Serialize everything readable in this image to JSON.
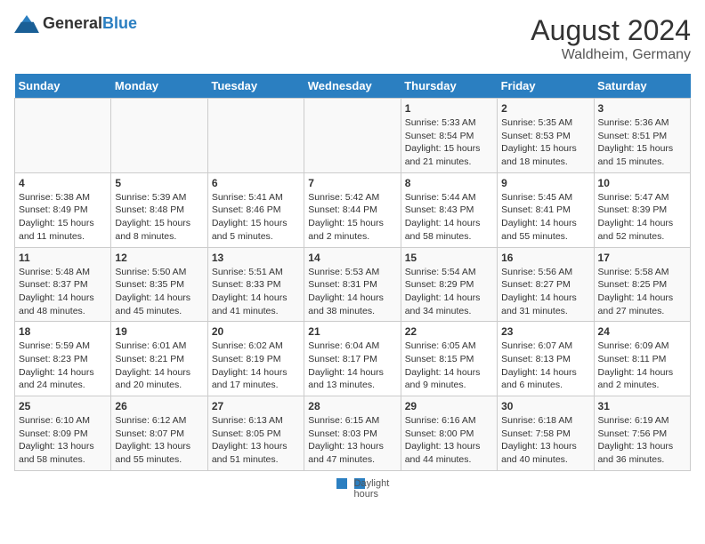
{
  "logo": {
    "text_general": "General",
    "text_blue": "Blue"
  },
  "title": {
    "month_year": "August 2024",
    "location": "Waldheim, Germany"
  },
  "calendar": {
    "headers": [
      "Sunday",
      "Monday",
      "Tuesday",
      "Wednesday",
      "Thursday",
      "Friday",
      "Saturday"
    ],
    "weeks": [
      [
        {
          "day": "",
          "info": ""
        },
        {
          "day": "",
          "info": ""
        },
        {
          "day": "",
          "info": ""
        },
        {
          "day": "",
          "info": ""
        },
        {
          "day": "1",
          "info": "Sunrise: 5:33 AM\nSunset: 8:54 PM\nDaylight: 15 hours and 21 minutes."
        },
        {
          "day": "2",
          "info": "Sunrise: 5:35 AM\nSunset: 8:53 PM\nDaylight: 15 hours and 18 minutes."
        },
        {
          "day": "3",
          "info": "Sunrise: 5:36 AM\nSunset: 8:51 PM\nDaylight: 15 hours and 15 minutes."
        }
      ],
      [
        {
          "day": "4",
          "info": "Sunrise: 5:38 AM\nSunset: 8:49 PM\nDaylight: 15 hours and 11 minutes."
        },
        {
          "day": "5",
          "info": "Sunrise: 5:39 AM\nSunset: 8:48 PM\nDaylight: 15 hours and 8 minutes."
        },
        {
          "day": "6",
          "info": "Sunrise: 5:41 AM\nSunset: 8:46 PM\nDaylight: 15 hours and 5 minutes."
        },
        {
          "day": "7",
          "info": "Sunrise: 5:42 AM\nSunset: 8:44 PM\nDaylight: 15 hours and 2 minutes."
        },
        {
          "day": "8",
          "info": "Sunrise: 5:44 AM\nSunset: 8:43 PM\nDaylight: 14 hours and 58 minutes."
        },
        {
          "day": "9",
          "info": "Sunrise: 5:45 AM\nSunset: 8:41 PM\nDaylight: 14 hours and 55 minutes."
        },
        {
          "day": "10",
          "info": "Sunrise: 5:47 AM\nSunset: 8:39 PM\nDaylight: 14 hours and 52 minutes."
        }
      ],
      [
        {
          "day": "11",
          "info": "Sunrise: 5:48 AM\nSunset: 8:37 PM\nDaylight: 14 hours and 48 minutes."
        },
        {
          "day": "12",
          "info": "Sunrise: 5:50 AM\nSunset: 8:35 PM\nDaylight: 14 hours and 45 minutes."
        },
        {
          "day": "13",
          "info": "Sunrise: 5:51 AM\nSunset: 8:33 PM\nDaylight: 14 hours and 41 minutes."
        },
        {
          "day": "14",
          "info": "Sunrise: 5:53 AM\nSunset: 8:31 PM\nDaylight: 14 hours and 38 minutes."
        },
        {
          "day": "15",
          "info": "Sunrise: 5:54 AM\nSunset: 8:29 PM\nDaylight: 14 hours and 34 minutes."
        },
        {
          "day": "16",
          "info": "Sunrise: 5:56 AM\nSunset: 8:27 PM\nDaylight: 14 hours and 31 minutes."
        },
        {
          "day": "17",
          "info": "Sunrise: 5:58 AM\nSunset: 8:25 PM\nDaylight: 14 hours and 27 minutes."
        }
      ],
      [
        {
          "day": "18",
          "info": "Sunrise: 5:59 AM\nSunset: 8:23 PM\nDaylight: 14 hours and 24 minutes."
        },
        {
          "day": "19",
          "info": "Sunrise: 6:01 AM\nSunset: 8:21 PM\nDaylight: 14 hours and 20 minutes."
        },
        {
          "day": "20",
          "info": "Sunrise: 6:02 AM\nSunset: 8:19 PM\nDaylight: 14 hours and 17 minutes."
        },
        {
          "day": "21",
          "info": "Sunrise: 6:04 AM\nSunset: 8:17 PM\nDaylight: 14 hours and 13 minutes."
        },
        {
          "day": "22",
          "info": "Sunrise: 6:05 AM\nSunset: 8:15 PM\nDaylight: 14 hours and 9 minutes."
        },
        {
          "day": "23",
          "info": "Sunrise: 6:07 AM\nSunset: 8:13 PM\nDaylight: 14 hours and 6 minutes."
        },
        {
          "day": "24",
          "info": "Sunrise: 6:09 AM\nSunset: 8:11 PM\nDaylight: 14 hours and 2 minutes."
        }
      ],
      [
        {
          "day": "25",
          "info": "Sunrise: 6:10 AM\nSunset: 8:09 PM\nDaylight: 13 hours and 58 minutes."
        },
        {
          "day": "26",
          "info": "Sunrise: 6:12 AM\nSunset: 8:07 PM\nDaylight: 13 hours and 55 minutes."
        },
        {
          "day": "27",
          "info": "Sunrise: 6:13 AM\nSunset: 8:05 PM\nDaylight: 13 hours and 51 minutes."
        },
        {
          "day": "28",
          "info": "Sunrise: 6:15 AM\nSunset: 8:03 PM\nDaylight: 13 hours and 47 minutes."
        },
        {
          "day": "29",
          "info": "Sunrise: 6:16 AM\nSunset: 8:00 PM\nDaylight: 13 hours and 44 minutes."
        },
        {
          "day": "30",
          "info": "Sunrise: 6:18 AM\nSunset: 7:58 PM\nDaylight: 13 hours and 40 minutes."
        },
        {
          "day": "31",
          "info": "Sunrise: 6:19 AM\nSunset: 7:56 PM\nDaylight: 13 hours and 36 minutes."
        }
      ]
    ]
  },
  "footer": {
    "label": "Daylight hours"
  }
}
